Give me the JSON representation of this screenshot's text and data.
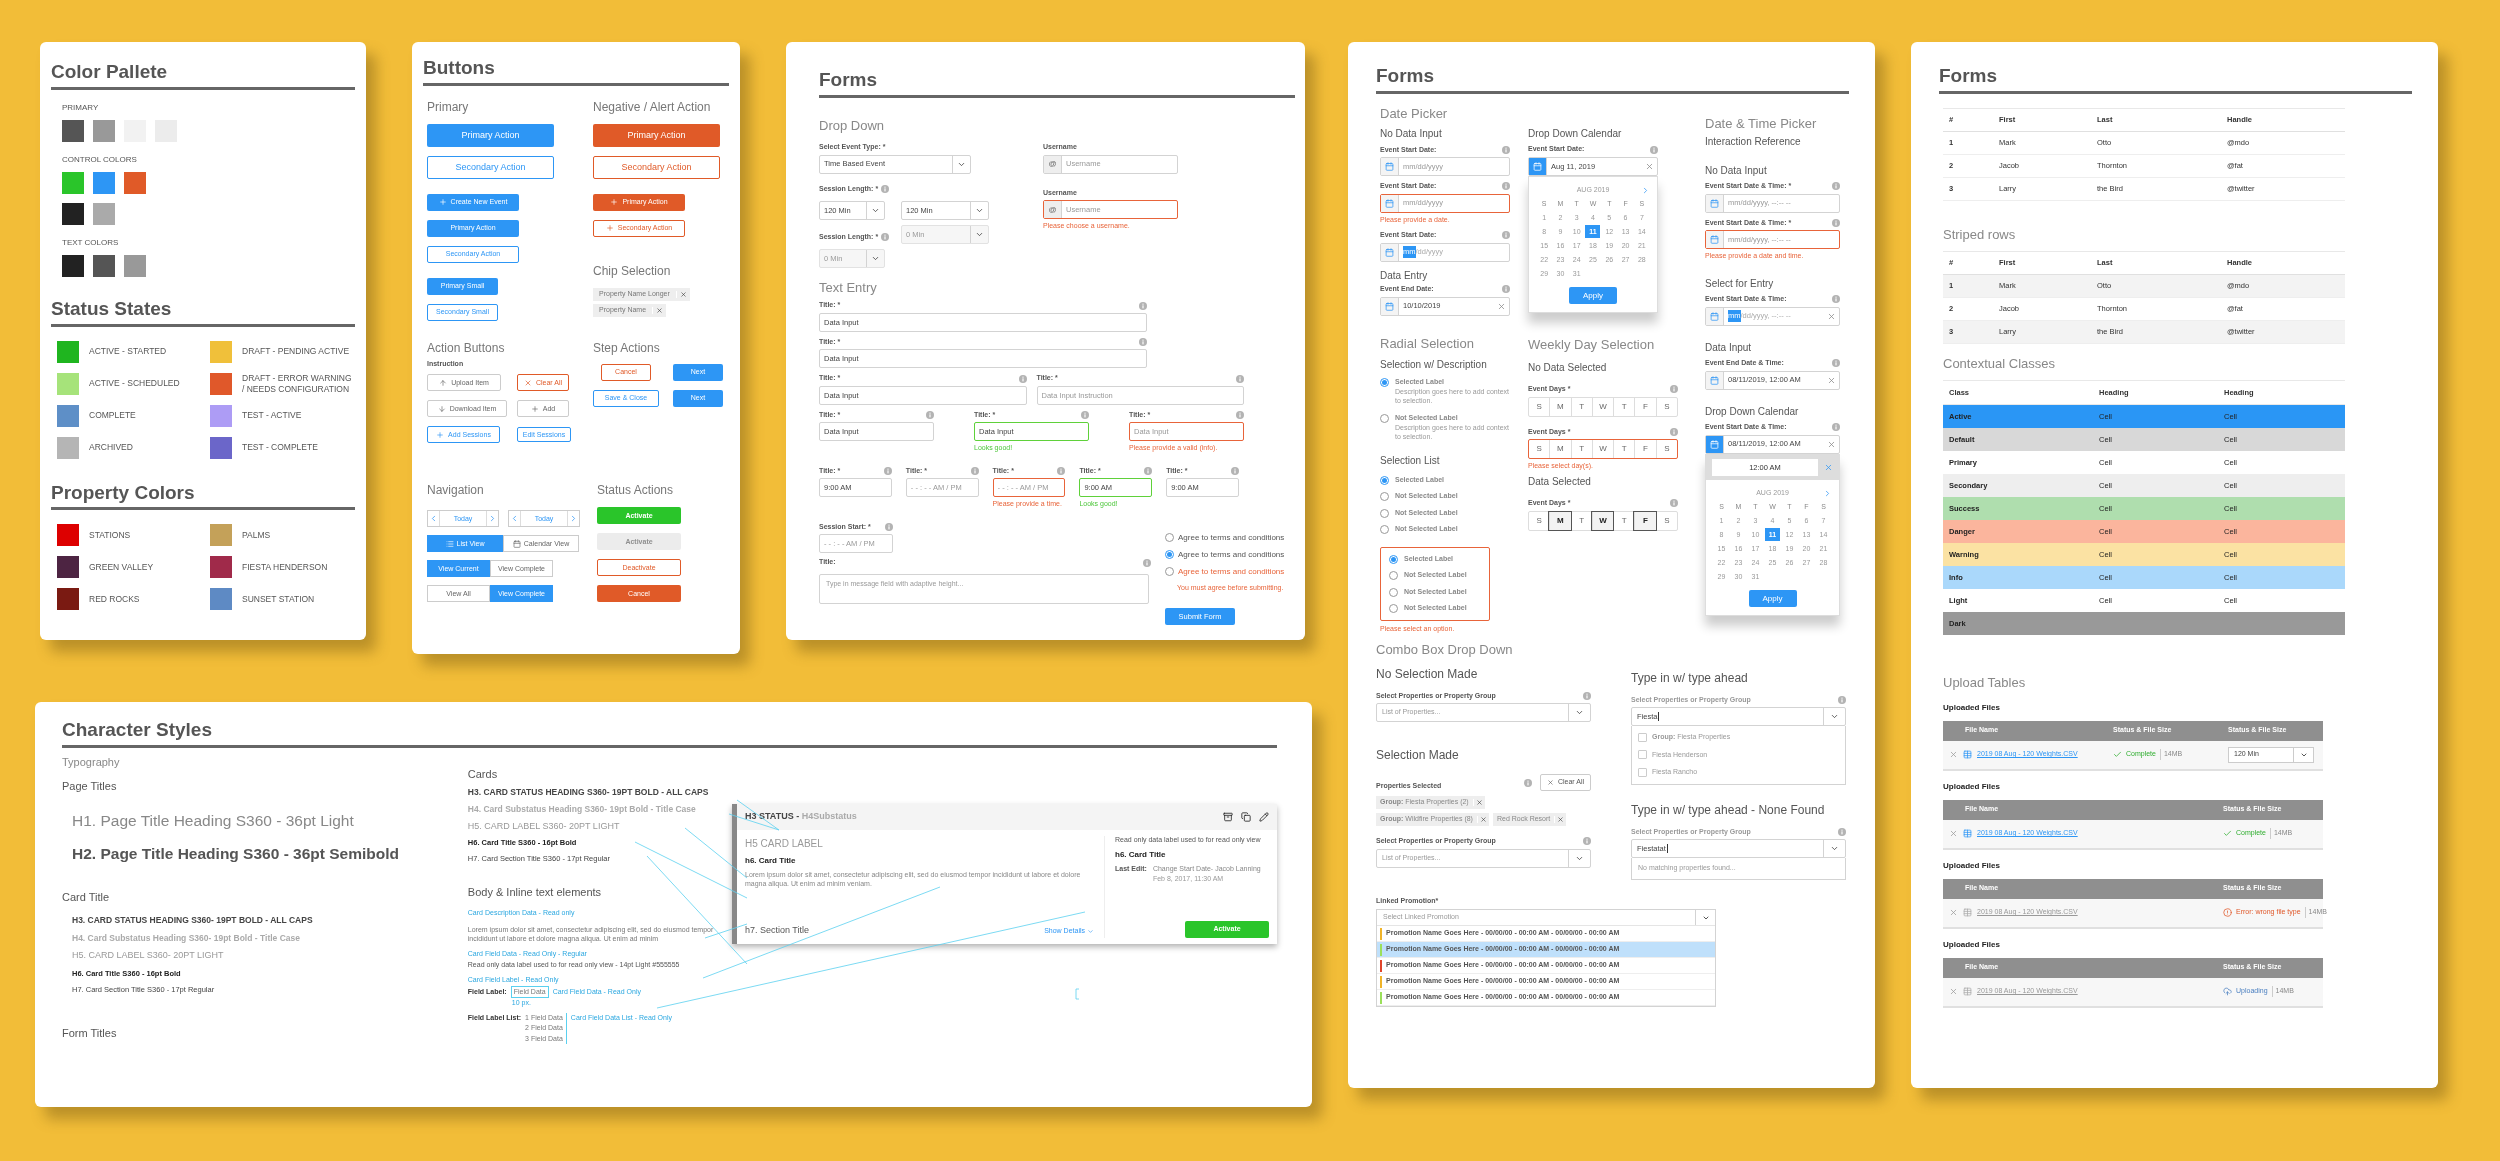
{
  "color_palette": {
    "title": "Color Pallete",
    "groups": [
      {
        "label": "PRIMARY",
        "swatches": [
          {
            "color": "#555555"
          },
          {
            "color": "#999999"
          },
          {
            "color": "#f2f2f2"
          },
          {
            "color": "#ececec"
          }
        ]
      },
      {
        "label": "CONTROL COLORS",
        "swatches": [
          {
            "color": "#2ac52a"
          },
          {
            "color": "#2d96f5"
          },
          {
            "color": "#e05a28"
          },
          {
            "color": "#222222"
          },
          {
            "color": "#aaaaaa"
          }
        ]
      },
      {
        "label": "TEXT COLORS",
        "swatches": [
          {
            "color": "#222222"
          },
          {
            "color": "#555555"
          },
          {
            "color": "#999999"
          }
        ]
      }
    ]
  },
  "status_states": {
    "title": "Status States",
    "items": [
      {
        "label": "ACTIVE - STARTED",
        "color": "#1fb51f"
      },
      {
        "label": "DRAFT - PENDING ACTIVE",
        "color": "#f0c03a"
      },
      {
        "label": "ACTIVE - SCHEDULED",
        "color": "#a6e37a"
      },
      {
        "label": "DRAFT  - ERROR WARNING / NEEDS CONFIGURATION",
        "color": "#e0582a"
      },
      {
        "label": "COMPLETE",
        "color": "#5e8fc7"
      },
      {
        "label": "TEST - ACTIVE",
        "color": "#ad9cf5"
      },
      {
        "label": "ARCHIVED",
        "color": "#b5b5b5"
      },
      {
        "label": "TEST - COMPLETE",
        "color": "#6b66c9"
      }
    ]
  },
  "property_colors": {
    "title": "Property Colors",
    "items": [
      {
        "label": "STATIONS",
        "color": "#dd0000"
      },
      {
        "label": "PALMS",
        "color": "#c4a159"
      },
      {
        "label": "GREEN VALLEY",
        "color": "#4d2442"
      },
      {
        "label": "FIESTA HENDERSON",
        "color": "#a02a4a"
      },
      {
        "label": "RED ROCKS",
        "color": "#7a1a12"
      },
      {
        "label": "SUNSET STATION",
        "color": "#5e8ac4"
      }
    ]
  },
  "buttons_panel": {
    "title": "Buttons",
    "primary": {
      "heading": "Primary",
      "buttons": [
        {
          "kind": "primary-lg",
          "label": "Primary Action"
        },
        {
          "kind": "secondary-lg",
          "label": "Secondary Action"
        },
        {
          "kind": "primary-add",
          "label": "Create New Event"
        },
        {
          "kind": "primary-md",
          "label": "Primary Action"
        },
        {
          "kind": "secondary-md",
          "label": "Secondary Action"
        },
        {
          "kind": "primary-sm",
          "label": "Primary Small"
        },
        {
          "kind": "secondary-sm",
          "label": "Secondary Small"
        }
      ]
    },
    "negative": {
      "heading": "Negative / Alert Action",
      "buttons": [
        {
          "kind": "danger-lg",
          "label": "Primary Action"
        },
        {
          "kind": "danger-outline-lg",
          "label": "Secondary Action"
        },
        {
          "kind": "danger-add",
          "label": "Primary Action"
        },
        {
          "kind": "danger-outline-add",
          "label": "Secondary Action"
        }
      ]
    },
    "chip_selection": {
      "heading": "Chip Selection",
      "chips": [
        "Property Name Longer",
        "Property Name"
      ]
    },
    "action_buttons": {
      "heading": "Action Buttons",
      "instruction": "Instruction",
      "buttons": [
        {
          "kind": "upload",
          "label": "Upload Item"
        },
        {
          "kind": "clear",
          "label": "Clear All"
        },
        {
          "kind": "download",
          "label": "Download Item"
        },
        {
          "kind": "add",
          "label": "Add"
        },
        {
          "kind": "add-blue",
          "label": "Add Sessions"
        },
        {
          "kind": "edit-blue",
          "label": "Edit Sessions"
        }
      ]
    },
    "step_actions": {
      "heading": "Step Actions",
      "buttons": [
        {
          "kind": "step-cancel",
          "label": "Cancel"
        },
        {
          "kind": "step-next",
          "label": "Next"
        },
        {
          "kind": "step-save",
          "label": "Save & Close"
        },
        {
          "kind": "step-next",
          "label": "Next"
        }
      ]
    },
    "navigation": {
      "heading": "Navigation",
      "date_navs": [
        "Today",
        "Today"
      ],
      "view_toggle": [
        {
          "label": "List View",
          "selected": true
        },
        {
          "label": "Calendar View",
          "selected": false
        }
      ],
      "toggles": [
        [
          {
            "label": "View Current",
            "selected": true
          },
          {
            "label": "View Complete",
            "selected": false
          }
        ],
        [
          {
            "label": "View All",
            "selected": false
          },
          {
            "label": "View Complete",
            "selected": true
          }
        ]
      ]
    },
    "status_actions": {
      "heading": "Status Actions",
      "buttons": [
        {
          "kind": "success",
          "label": "Activate",
          "disabled": false
        },
        {
          "kind": "success",
          "label": "Activate",
          "disabled": true
        },
        {
          "kind": "danger-outline",
          "label": "Deactivate",
          "disabled": false
        },
        {
          "kind": "danger",
          "label": "Cancel",
          "disabled": false
        }
      ]
    }
  },
  "forms_basic": {
    "title": "Forms",
    "drop_down": {
      "heading": "Drop Down",
      "event_type": {
        "label": "Select Event Type: *",
        "value": "Time Based Event"
      },
      "sessions": [
        {
          "label": "Session Length: *",
          "info": true,
          "selects": [
            {
              "value": "120 Min",
              "disabled": false
            },
            {
              "value": "120 Min",
              "disabled": false
            }
          ]
        },
        {
          "label": "Session Length: *",
          "info": true,
          "selects": [
            {
              "value": "0 Min",
              "disabled": true
            },
            {
              "value": "0 Min",
              "disabled": true
            }
          ]
        }
      ],
      "usernames": [
        {
          "label": "Username",
          "prefix": "@",
          "placeholder": "Username",
          "invalid": false
        },
        {
          "label": "Username",
          "prefix": "@",
          "placeholder": "Username",
          "invalid": true,
          "message": "Please choose a username."
        }
      ]
    },
    "text_entry": {
      "heading": "Text Entry",
      "rows": [
        [
          {
            "label": "Title: *",
            "info": true,
            "value": "Data Input",
            "invalid": false,
            "valid": false
          }
        ],
        [
          {
            "label": "Title: *",
            "info": true,
            "value": "Data Input",
            "invalid": false,
            "valid": false
          }
        ],
        [
          {
            "label": "Title: *",
            "info": true,
            "value": "Data Input",
            "invalid": false,
            "valid": false
          },
          {
            "label": "Title: *",
            "info": true,
            "placeholder": "Data Input Instruction",
            "invalid": false,
            "valid": false
          }
        ],
        [
          {
            "label": "Title: *",
            "info": true,
            "value": "Data Input",
            "invalid": false,
            "valid": false
          },
          {
            "label": "Title: *",
            "info": true,
            "value": "Data Input",
            "invalid": false,
            "valid": true,
            "message": "Looks good!"
          },
          {
            "label": "Title: *",
            "info": true,
            "placeholder": "Data Input",
            "invalid": true,
            "valid": false,
            "message": "Please provide a valid (info)."
          }
        ]
      ],
      "times": [
        {
          "label": "Title: *",
          "info": true,
          "value": "9:00 AM",
          "invalid": false,
          "valid": false
        },
        {
          "label": "Title: *",
          "info": true,
          "placeholder": "- - : - - AM / PM",
          "invalid": false,
          "valid": false
        },
        {
          "label": "Title: *",
          "info": true,
          "placeholder": "- - : - - AM / PM",
          "invalid": true,
          "valid": false,
          "message": "Please provide a time."
        },
        {
          "label": "Title: *",
          "info": true,
          "value": "9:00 AM",
          "invalid": false,
          "valid": true,
          "message": "Looks good!"
        },
        {
          "label": "Title: *",
          "info": true,
          "value": "9:00 AM",
          "invalid": false,
          "valid": false
        }
      ],
      "session_start": {
        "label": "Session Start: *",
        "info": true,
        "placeholder": "- - : - - AM / PM"
      },
      "message": {
        "label": "Title:",
        "info": true,
        "placeholder": "Type in message field with adaptive height..."
      },
      "agree": [
        {
          "label": "Agree to terms and conditions",
          "selected": false,
          "invalid": false
        },
        {
          "label": "Agree to terms and conditions",
          "selected": true,
          "invalid": false
        },
        {
          "label": "Agree to terms and conditions",
          "selected": false,
          "invalid": true
        }
      ],
      "agree_error": "You must agree before submitting.",
      "submit": "Submit Form"
    }
  },
  "forms_pickers": {
    "title": "Forms",
    "date_picker": {
      "heading": "Date Picker",
      "subheading": "No Data Input",
      "fields": [
        {
          "label": "Event Start Date:",
          "info": true,
          "placeholder": "mm/dd/yyyy",
          "invalid": false
        },
        {
          "label": "Event Start Date:",
          "info": true,
          "placeholder": "mm/dd/yyyy",
          "invalid": true,
          "message": "Please provide a date."
        },
        {
          "label": "Event Start Date:",
          "info": true,
          "selected_part": "mm",
          "rest": "/dd/yyyy",
          "invalid": false
        }
      ],
      "entry_subheading": "Data Entry",
      "entry": {
        "label": "Event End Date:",
        "info": true,
        "value": "10/10/2019",
        "clear": true
      }
    },
    "drop_down_calendar": {
      "subheading": "Drop Down Calendar",
      "field": {
        "label": "Event Start Date:",
        "info": true,
        "value": "Aug 11, 2019",
        "clear": true,
        "open": true
      },
      "calendar": {
        "month": "AUG 2019",
        "weekdays": [
          "S",
          "M",
          "T",
          "W",
          "T",
          "F",
          "S"
        ],
        "apply": "Apply",
        "days": [
          {
            "label": "1",
            "selected": false
          },
          {
            "label": "2",
            "selected": false
          },
          {
            "label": "3",
            "selected": false
          },
          {
            "label": "4",
            "selected": false
          },
          {
            "label": "5",
            "selected": false
          },
          {
            "label": "6",
            "selected": false
          },
          {
            "label": "7",
            "selected": false
          },
          {
            "label": "8",
            "selected": false
          },
          {
            "label": "9",
            "selected": false
          },
          {
            "label": "10",
            "selected": false
          },
          {
            "label": "11",
            "selected": true
          },
          {
            "label": "12",
            "selected": false
          },
          {
            "label": "13",
            "selected": false
          },
          {
            "label": "14",
            "selected": false
          },
          {
            "label": "15",
            "selected": false
          },
          {
            "label": "16",
            "selected": false
          },
          {
            "label": "17",
            "selected": false
          },
          {
            "label": "18",
            "selected": false
          },
          {
            "label": "19",
            "selected": false
          },
          {
            "label": "20",
            "selected": false
          },
          {
            "label": "21",
            "selected": false
          },
          {
            "label": "22",
            "selected": false
          },
          {
            "label": "23",
            "selected": false
          },
          {
            "label": "24",
            "selected": false
          },
          {
            "label": "25",
            "selected": false
          },
          {
            "label": "26",
            "selected": false
          },
          {
            "label": "27",
            "selected": false
          },
          {
            "label": "28",
            "selected": false
          },
          {
            "label": "29",
            "selected": false
          },
          {
            "label": "30",
            "selected": false
          },
          {
            "label": "31",
            "selected": false
          }
        ]
      }
    },
    "date_time_picker": {
      "heading": "Date & Time Picker",
      "subheading": "Interaction Reference",
      "groups": [
        {
          "subheading": "No Data Input",
          "fields": [
            {
              "label": "Event Start Date & Time: *",
              "info": true,
              "placeholder": "mm/dd/yyyy, --:-- --",
              "invalid": false
            },
            {
              "label": "Event Start Date & Time: *",
              "info": true,
              "placeholder": "mm/dd/yyyy, --:-- --",
              "invalid": true,
              "message": "Please provide a date and time."
            }
          ]
        },
        {
          "subheading": "Select for Entry",
          "fields": [
            {
              "label": "Event Start Date & Time:",
              "info": true,
              "selected_part": "mm",
              "rest": "/dd/yyyy, --:-- --",
              "clear": true
            }
          ]
        },
        {
          "subheading": "Data Input",
          "fields": [
            {
              "label": "Event End Date & Time:",
              "info": true,
              "value": "08/11/2019, 12:00 AM",
              "clear": true
            }
          ]
        },
        {
          "subheading": "Drop Down Calendar",
          "fields": [
            {
              "label": "Event Start Date & Time:",
              "info": true,
              "value": "08/11/2019, 12:00 AM",
              "clear": true,
              "open": true
            }
          ],
          "calendar": {
            "time": "12:00 AM",
            "month": "AUG 2019",
            "weekdays": [
              "S",
              "M",
              "T",
              "W",
              "T",
              "F",
              "S"
            ],
            "apply": "Apply",
            "days": [
              {
                "label": "1",
                "selected": false
              },
              {
                "label": "2",
                "selected": false
              },
              {
                "label": "3",
                "selected": false
              },
              {
                "label": "4",
                "selected": false
              },
              {
                "label": "5",
                "selected": false
              },
              {
                "label": "6",
                "selected": false
              },
              {
                "label": "7",
                "selected": false
              },
              {
                "label": "8",
                "selected": false
              },
              {
                "label": "9",
                "selected": false
              },
              {
                "label": "10",
                "selected": false
              },
              {
                "label": "11",
                "selected": true
              },
              {
                "label": "12",
                "selected": false
              },
              {
                "label": "13",
                "selected": false
              },
              {
                "label": "14",
                "selected": false
              },
              {
                "label": "15",
                "selected": false
              },
              {
                "label": "16",
                "selected": false
              },
              {
                "label": "17",
                "selected": false
              },
              {
                "label": "18",
                "selected": false
              },
              {
                "label": "19",
                "selected": false
              },
              {
                "label": "20",
                "selected": false
              },
              {
                "label": "21",
                "selected": false
              },
              {
                "label": "22",
                "selected": false
              },
              {
                "label": "23",
                "selected": false
              },
              {
                "label": "24",
                "selected": false
              },
              {
                "label": "25",
                "selected": false
              },
              {
                "label": "26",
                "selected": false
              },
              {
                "label": "27",
                "selected": false
              },
              {
                "label": "28",
                "selected": false
              },
              {
                "label": "29",
                "selected": false
              },
              {
                "label": "30",
                "selected": false
              },
              {
                "label": "31",
                "selected": false
              }
            ]
          }
        }
      ]
    },
    "radial_selection": {
      "heading": "Radial Selection",
      "subheading": "Selection w/ Description",
      "options": [
        {
          "label": "Selected Label",
          "description": "Description goes here to add context to selection.",
          "selected": true
        },
        {
          "label": "Not Selected Label",
          "description": "Description goes here to add context to selection.",
          "selected": false
        }
      ]
    },
    "selection_list": {
      "heading": "Selection List",
      "options": [
        {
          "label": "Selected Label",
          "selected": true
        },
        {
          "label": "Not Selected Label",
          "selected": false
        },
        {
          "label": "Not Selected Label",
          "selected": false
        },
        {
          "label": "Not Selected Label",
          "selected": false
        }
      ],
      "invalid_options": [
        {
          "label": "Selected Label",
          "selected": true
        },
        {
          "label": "Not Selected Label",
          "selected": false
        },
        {
          "label": "Not Selected Label",
          "selected": false
        },
        {
          "label": "Not Selected Label",
          "selected": false
        }
      ],
      "error": "Please select an option."
    },
    "weekly": {
      "heading": "Weekly Day Selection",
      "groups": [
        {
          "subheading": "No Data Selected",
          "label": "Event Days *",
          "info": true,
          "invalid": false,
          "days": [
            {
              "label": "S",
              "selected": false
            },
            {
              "label": "M",
              "selected": false
            },
            {
              "label": "T",
              "selected": false
            },
            {
              "label": "W",
              "selected": false
            },
            {
              "label": "T",
              "selected": false
            },
            {
              "label": "F",
              "selected": false
            },
            {
              "label": "S",
              "selected": false
            }
          ]
        },
        {
          "label": "Event Days *",
          "info": true,
          "invalid": true,
          "message": "Please select day(s).",
          "days": [
            {
              "label": "S",
              "selected": false
            },
            {
              "label": "M",
              "selected": false
            },
            {
              "label": "T",
              "selected": false
            },
            {
              "label": "W",
              "selected": false
            },
            {
              "label": "T",
              "selected": false
            },
            {
              "label": "F",
              "selected": false
            },
            {
              "label": "S",
              "selected": false
            }
          ]
        },
        {
          "subheading": "Data Selected",
          "label": "Event Days *",
          "info": true,
          "invalid": false,
          "days": [
            {
              "label": "S",
              "selected": false
            },
            {
              "label": "M",
              "selected": true
            },
            {
              "label": "T",
              "selected": false
            },
            {
              "label": "W",
              "selected": true
            },
            {
              "label": "T",
              "selected": false
            },
            {
              "label": "F",
              "selected": true
            },
            {
              "label": "S",
              "selected": false
            }
          ]
        }
      ]
    },
    "combo": {
      "heading": "Combo Box Drop Down",
      "no_selection": {
        "subheading": "No Selection Made",
        "label": "Select Properties or Property Group",
        "info": true,
        "placeholder": "List of Properties..."
      },
      "selection_made": {
        "subheading": "Selection Made",
        "label": "Properties Selected",
        "info": true,
        "clear": "Clear All",
        "chips": [
          "**Group:** Fiesta Properties (2)",
          "**Group:** Wildfire Properties (8)",
          "Red Rock Resort"
        ],
        "select": {
          "label": "Select Properties or Property Group",
          "info": true,
          "placeholder": "List of Properties..."
        }
      },
      "typeahead": {
        "subheading": "Type in w/ type ahead",
        "label": "**Select Propert**ies or Property Group",
        "info": true,
        "value": "Fiesta",
        "options": [
          {
            "label": "**Group:** Fiesta Properties",
            "checked": false
          },
          {
            "label": "Fiesta Henderson",
            "checked": false
          },
          {
            "label": "Fiesta Rancho",
            "checked": false
          }
        ]
      },
      "none_found": {
        "subheading": "Type in w/ type ahead - None Found",
        "label": "**Select Propert**ies or Property Group",
        "info": true,
        "value": "Fiestatat",
        "message": "No matching properties found..."
      }
    },
    "linked_promotion": {
      "label": "Linked Promotion*",
      "placeholder": "Select Linked Promotion",
      "options": [
        {
          "label": "Promotion Name Goes Here - 00/00/00 - 00:00 AM - 00/00/00 - 00:00 AM",
          "color": "#f0b429",
          "selected": false
        },
        {
          "label": "Promotion Name Goes Here - 00/00/00 - 00:00 AM - 00/00/00 - 00:00 AM",
          "color": "#9be05a",
          "selected": true
        },
        {
          "label": "Promotion Name Goes Here - 00/00/00 - 00:00 AM - 00/00/00 - 00:00 AM",
          "color": "#e0442a",
          "selected": false
        },
        {
          "label": "Promotion Name Goes Here - 00/00/00 - 00:00 AM - 00/00/00 - 00:00 AM",
          "color": "#f0b429",
          "selected": false
        },
        {
          "label": "Promotion Name Goes Here - 00/00/00 - 00:00 AM - 00/00/00 - 00:00 AM",
          "color": "#9be05a",
          "selected": false
        }
      ]
    }
  },
  "forms_tables": {
    "title": "Forms",
    "basic": {
      "striped": false,
      "columns": [
        "#",
        "First",
        "Last",
        "Handle"
      ],
      "rows": [
        [
          "1",
          "Mark",
          "Otto",
          "@mdo"
        ],
        [
          "2",
          "Jacob",
          "Thornton",
          "@fat"
        ],
        [
          "3",
          "Larry",
          "the Bird",
          "@twitter"
        ]
      ]
    },
    "striped": {
      "heading": "Striped rows",
      "striped": true,
      "columns": [
        "#",
        "First",
        "Last",
        "Handle"
      ],
      "rows": [
        [
          "1",
          "Mark",
          "Otto",
          "@mdo"
        ],
        [
          "2",
          "Jacob",
          "Thornton",
          "@fat"
        ],
        [
          "3",
          "Larry",
          "the Bird",
          "@twitter"
        ]
      ]
    },
    "contextual": {
      "heading": "Contextual Classes",
      "columns": [
        "Class",
        "Heading",
        "Heading"
      ],
      "rows": [
        {
          "cells": [
            "Active",
            "Cell",
            "Cell"
          ],
          "color": "#2a96f5"
        },
        {
          "cells": [
            "Default",
            "Cell",
            "Cell"
          ],
          "color": "#d8d8d8"
        },
        {
          "cells": [
            "Primary",
            "Cell",
            "Cell"
          ],
          "color": "#ffffff"
        },
        {
          "cells": [
            "Secondary",
            "Cell",
            "Cell"
          ],
          "color": "#eeeeee"
        },
        {
          "cells": [
            "Success",
            "Cell",
            "Cell"
          ],
          "color": "#afdeae"
        },
        {
          "cells": [
            "Danger",
            "Cell",
            "Cell"
          ],
          "color": "#fbb59d"
        },
        {
          "cells": [
            "Warning",
            "Cell",
            "Cell"
          ],
          "color": "#fbe2a3"
        },
        {
          "cells": [
            "Info",
            "Cell",
            "Cell"
          ],
          "color": "#aad8fb"
        },
        {
          "cells": [
            "Light",
            "Cell",
            "Cell"
          ],
          "color": "#ffffff"
        },
        {
          "cells": [
            "Dark"
          ],
          "color": "#999999"
        }
      ]
    },
    "uploads": {
      "heading": "Upload Tables",
      "tables": [
        {
          "title": "Uploaded Files",
          "columns": [
            "File Name",
            "Status & File Size",
            "Status & File Size"
          ],
          "file": "2019 08 Aug - 120 Weights.CSV",
          "disabled": false,
          "kind": "complete",
          "status_text": "Complete",
          "size": "14MB",
          "select": "120 Min"
        },
        {
          "title": "Uploaded Files",
          "columns": [
            "File Name",
            "Status & File Size"
          ],
          "file": "2019 08 Aug - 120 Weights.CSV",
          "disabled": false,
          "kind": "complete",
          "status_text": "Complete",
          "size": "14MB"
        },
        {
          "title": "Uploaded Files",
          "columns": [
            "File Name",
            "Status & File Size"
          ],
          "file": "2019 08 Aug - 120 Weights.CSV",
          "disabled": true,
          "kind": "error",
          "status_text": "Error: wrong file type",
          "size": "14MB"
        },
        {
          "title": "Uploaded Files",
          "columns": [
            "File Name",
            "Status & File Size"
          ],
          "file": "2019 08 Aug - 120 Weights.CSV",
          "disabled": true,
          "kind": "uploading",
          "status_text": "Uploading",
          "size": "14MB"
        }
      ]
    }
  },
  "character_styles": {
    "title": "Character Styles",
    "typography": "Typography",
    "page_titles": {
      "heading": "Page Titles",
      "h1": "H1. Page Title Heading S360 - 36pt Light",
      "h2": "H2. Page Title Heading S360 - 36pt Semibold"
    },
    "card_title": {
      "heading": "Card Title",
      "styles": [
        "H3. CARD STATUS HEADING S360- 19PT BOLD - ALL CAPS",
        "H4. Card Substatus Heading S360- 19pt Bold - Title Case",
        "H5. CARD LABEL S360- 20PT LIGHT",
        "H6. Card Title S360 - 16pt Bold",
        "H7. Card Section Title S360 - 17pt Regular"
      ]
    },
    "form_titles": "Form Titles",
    "cards": {
      "heading": "Cards",
      "styles": [
        "H3. CARD STATUS HEADING S360- 19PT BOLD - ALL CAPS",
        "H4. Card Substatus Heading S360- 19pt Bold - Title Case",
        "H5. CARD LABEL S360- 20PT LIGHT",
        "H6. Card Title S360 - 16pt Bold",
        "H7. Card Section Title S360 - 17pt Regular"
      ]
    },
    "body": {
      "heading": "Body & Inline text elements",
      "desc_note": "Card Description Data - Read only",
      "lorem": "Lorem ipsum dolor sit amet, consectetur adipiscing elit, sed do eiusmod tempor incididunt ut labore et dolore magna aliqua. Ut enim ad minim",
      "field_note": "Card Field Data - Read Only - Regular",
      "field_text": "Read only data label used to for read only view - 14pt  Light #555555",
      "label_note": "Card Field Label - Read Only",
      "field_label": "Field Label:",
      "field_data": "Field Data",
      "field_data_note": "Card Field Data - Read Only",
      "spacing_note": "10 px.",
      "list_label": "Field Label List:",
      "list_items": [
        "1 Field Data",
        "2 Field Data",
        "3 Field Data"
      ],
      "list_note": "Card Field Data List - Read Only"
    },
    "sample_card": {
      "status": "H3 STATUS - ",
      "substatus": "H4Substatus",
      "label": "H5 CARD LABEL",
      "title": "h6. Card Title",
      "lorem": "Lorem ipsum dolor sit amet, consectetur adipiscing elit, sed do eiusmod tempor incididunt ut labore et dolore magna aliqua. Ut enim ad minim veniam.",
      "section": "h7. Section Title",
      "show_details": "Show Details",
      "note": "Read only data label used to for read only view",
      "side_title": "h6. Card Title",
      "last_edit_label": "Last Edit:",
      "last_edit": "Change Start Date- Jacob Lanning",
      "last_edit_date": "Feb 8, 2017, 11:30 AM",
      "action": "Activate"
    }
  }
}
